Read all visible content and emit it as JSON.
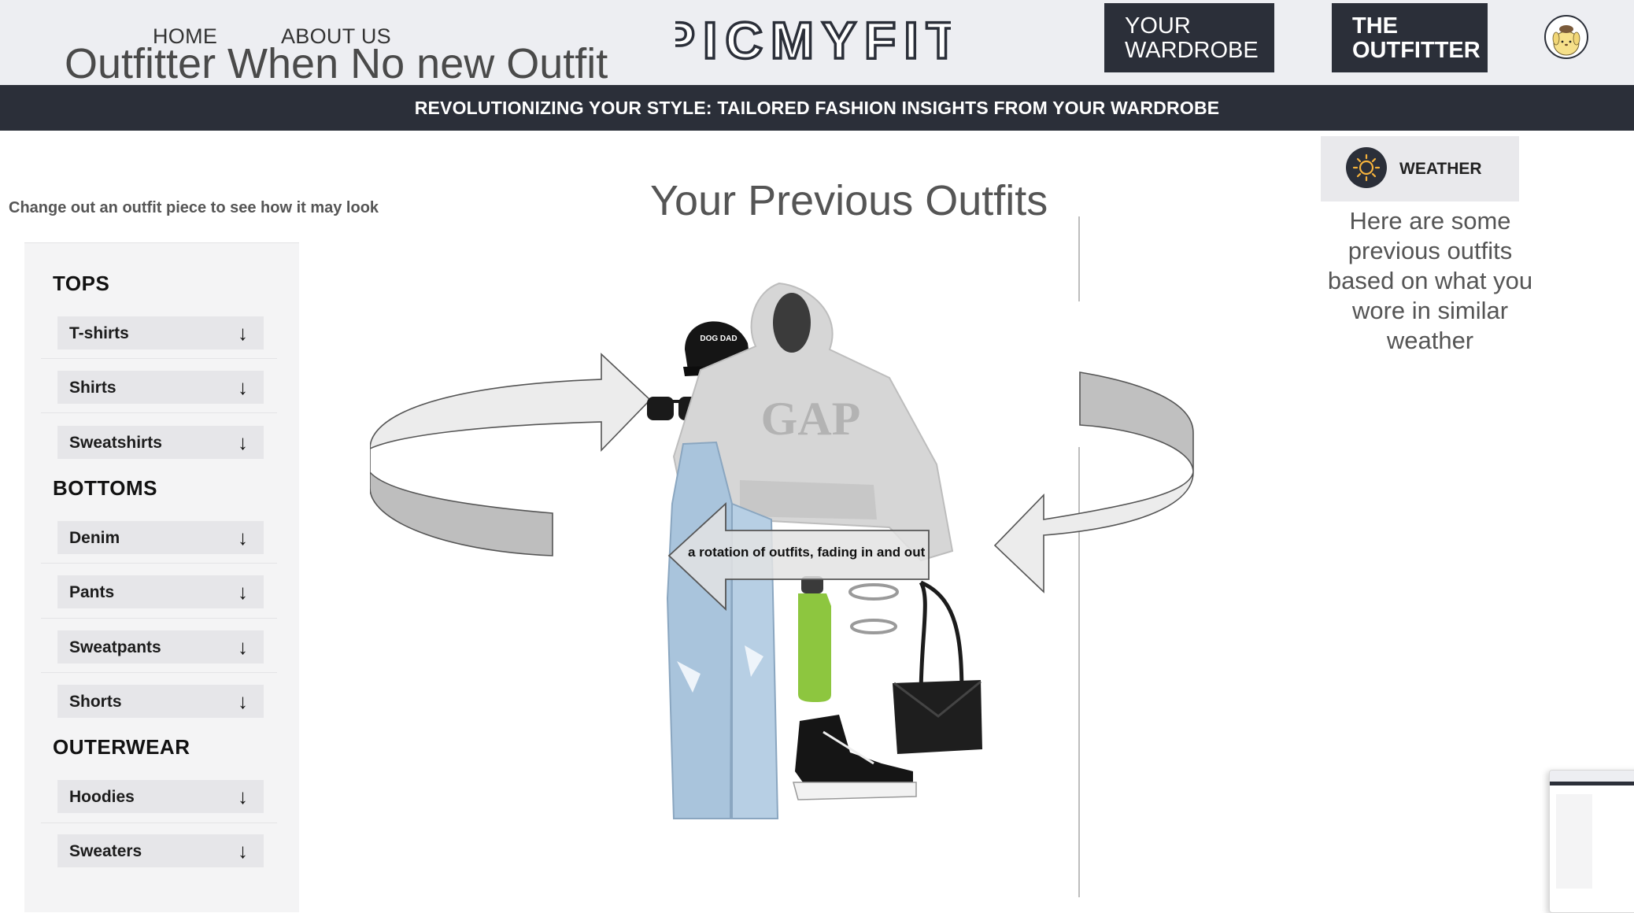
{
  "header": {
    "nav": [
      "HOME",
      "ABOUT US"
    ],
    "page_heading": "Outfitter When No new Outfit",
    "logo_text": "PICMYFIT",
    "wardrobe_button": "YOUR WARDROBE",
    "outfitter_button": "THE OUTFITTER"
  },
  "banner": "REVOLUTIONIZING YOUR STYLE: TAILORED FASHION INSIGHTS FROM YOUR WARDROBE",
  "sidebar": {
    "hint": "Change out an outfit piece to see how it may look",
    "dropdown_icon": "↓",
    "categories": [
      {
        "title": "TOPS",
        "items": [
          "T-shirts",
          "Shirts",
          "Sweatshirts"
        ]
      },
      {
        "title": "BOTTOMS",
        "items": [
          "Denim",
          "Pants",
          "Sweatpants",
          "Shorts"
        ]
      },
      {
        "title": "OUTERWEAR",
        "items": [
          "Hoodies",
          "Sweaters"
        ]
      }
    ]
  },
  "main": {
    "title": "Your Previous Outfits",
    "caption": "a rotation of outfits, fading in and out",
    "cap_text": "DOG DAD",
    "hoodie_text": "GAP"
  },
  "weather": {
    "label": "WEATHER",
    "description": "Here are some previous outfits based on what you wore in similar weather",
    "icon": "sun-icon"
  },
  "colors": {
    "dark": "#2b2f39",
    "header_bg": "#edeef2",
    "panel_bg": "#f4f4f5"
  }
}
